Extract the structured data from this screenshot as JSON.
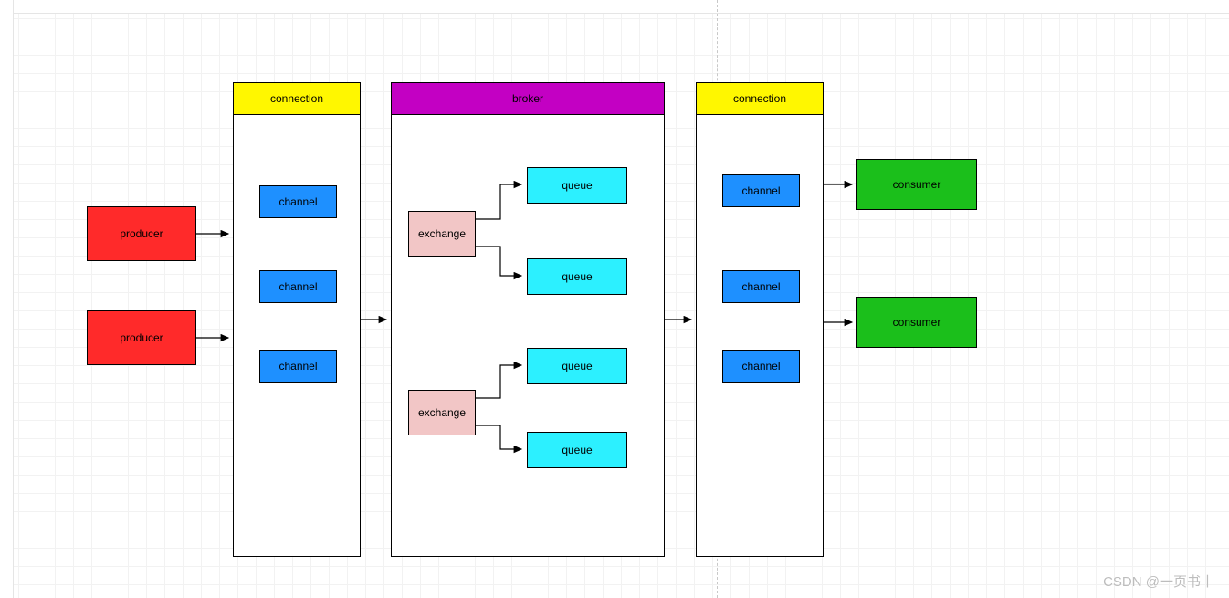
{
  "colors": {
    "producer": "#ff2a2a",
    "channel": "#1e90ff",
    "connection_header": "#fff700",
    "broker_header": "#c300c3",
    "exchange": "#f2c6c6",
    "queue": "#2cf0ff",
    "consumer": "#1bbf1b",
    "container_bg": "#ffffff"
  },
  "nodes": {
    "producer1": "producer",
    "producer2": "producer",
    "connection_left_header": "connection",
    "channel_l1": "channel",
    "channel_l2": "channel",
    "channel_l3": "channel",
    "broker_header": "broker",
    "exchange1": "exchange",
    "exchange2": "exchange",
    "queue1": "queue",
    "queue2": "queue",
    "queue3": "queue",
    "queue4": "queue",
    "connection_right_header": "connection",
    "channel_r1": "channel",
    "channel_r2": "channel",
    "channel_r3": "channel",
    "consumer1": "consumer",
    "consumer2": "consumer"
  },
  "watermark": "CSDN @一页书丨",
  "arrows": [
    {
      "from": "producer1",
      "to": "connection_left"
    },
    {
      "from": "producer2",
      "to": "connection_left"
    },
    {
      "from": "connection_left",
      "to": "broker"
    },
    {
      "from": "exchange1",
      "to": "queue1"
    },
    {
      "from": "exchange1",
      "to": "queue2"
    },
    {
      "from": "exchange2",
      "to": "queue3"
    },
    {
      "from": "exchange2",
      "to": "queue4"
    },
    {
      "from": "broker",
      "to": "connection_right"
    },
    {
      "from": "connection_right",
      "to": "consumer1"
    },
    {
      "from": "connection_right",
      "to": "consumer2"
    }
  ]
}
